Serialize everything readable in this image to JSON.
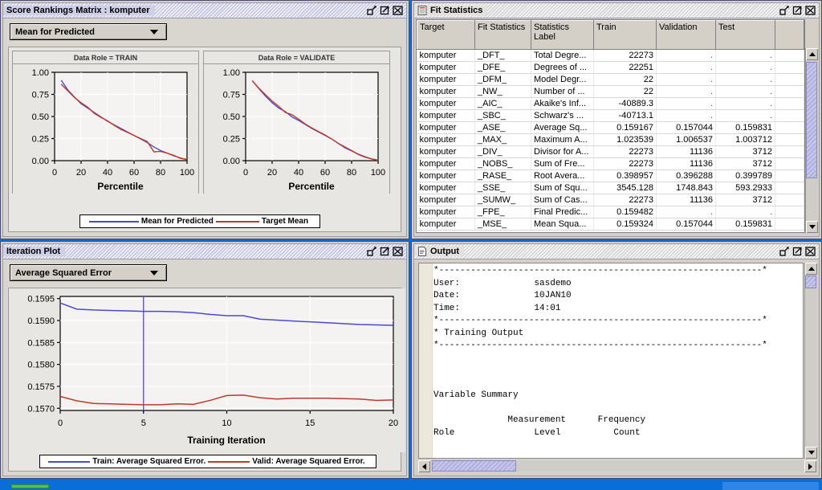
{
  "windows": {
    "score_rankings": {
      "title": "Score Rankings Matrix : komputer",
      "combo_value": "Mean for Predicted",
      "panels": [
        {
          "header": "Data Role = TRAIN",
          "xlabel": "Percentile"
        },
        {
          "header": "Data Role = VALIDATE",
          "xlabel": "Percentile"
        }
      ],
      "legend": [
        {
          "label": "Mean for Predicted",
          "color": "#4a4ad0"
        },
        {
          "label": "Target Mean",
          "color": "#c0392b"
        }
      ]
    },
    "fit_statistics": {
      "title": "Fit Statistics",
      "columns": [
        "Target",
        "Fit Statistics",
        "Statistics Label",
        "Train",
        "Validation",
        "Test",
        ""
      ],
      "rows": [
        [
          "komputer",
          "_DFT_",
          "Total Degre...",
          "22273",
          ".",
          "."
        ],
        [
          "komputer",
          "_DFE_",
          "Degrees of ...",
          "22251",
          ".",
          "."
        ],
        [
          "komputer",
          "_DFM_",
          "Model Degr...",
          "22",
          ".",
          "."
        ],
        [
          "komputer",
          "_NW_",
          "Number of ...",
          "22",
          ".",
          "."
        ],
        [
          "komputer",
          "_AIC_",
          "Akaike's Inf...",
          "-40889.3",
          ".",
          "."
        ],
        [
          "komputer",
          "_SBC_",
          "Schwarz's ...",
          "-40713.1",
          ".",
          "."
        ],
        [
          "komputer",
          "_ASE_",
          "Average Sq...",
          "0.159167",
          "0.157044",
          "0.159831"
        ],
        [
          "komputer",
          "_MAX_",
          "Maximum A...",
          "1.023539",
          "1.006537",
          "1.003712"
        ],
        [
          "komputer",
          "_DIV_",
          "Divisor for A...",
          "22273",
          "11136",
          "3712"
        ],
        [
          "komputer",
          "_NOBS_",
          "Sum of Fre...",
          "22273",
          "11136",
          "3712"
        ],
        [
          "komputer",
          "_RASE_",
          "Root Avera...",
          "0.398957",
          "0.396288",
          "0.399789"
        ],
        [
          "komputer",
          "_SSE_",
          "Sum of Squ...",
          "3545.128",
          "1748.843",
          "593.2933"
        ],
        [
          "komputer",
          "_SUMW_",
          "Sum of Cas...",
          "22273",
          "11136",
          "3712"
        ],
        [
          "komputer",
          "_FPE_",
          "Final Predic...",
          "0.159482",
          ".",
          "."
        ],
        [
          "komputer",
          "_MSE_",
          "Mean Squa...",
          "0.159324",
          "0.157044",
          "0.159831"
        ]
      ]
    },
    "iteration_plot": {
      "title": "Iteration Plot",
      "combo_value": "Average Squared Error",
      "legend": [
        {
          "label": "Train: Average Squared Error.",
          "color": "#4a4ad0"
        },
        {
          "label": "Valid: Average Squared Error.",
          "color": "#c0392b"
        }
      ]
    },
    "output": {
      "title": "Output",
      "text": "*-------------------------------------------------------------*\nUser:              sasdemo\nDate:              10JAN10\nTime:              14:01\n*-------------------------------------------------------------*\n* Training Output\n*-------------------------------------------------------------*\n\n\n\nVariable Summary\n\n              Measurement      Frequency\nRole               Level          Count"
    }
  },
  "titlebar_buttons": [
    {
      "name": "restore-button",
      "glyph": "restore"
    },
    {
      "name": "maximize-button",
      "glyph": "maximize"
    },
    {
      "name": "close-button",
      "glyph": "close"
    }
  ],
  "chart_data": [
    {
      "type": "line",
      "title": "Data Role = TRAIN",
      "xlabel": "Percentile",
      "ylabel": "",
      "xlim": [
        0,
        100
      ],
      "ylim": [
        0.0,
        1.0
      ],
      "xticks": [
        0,
        20,
        40,
        60,
        80,
        100
      ],
      "yticks": [
        "0.00",
        "0.25",
        "0.50",
        "0.75",
        "1.00"
      ],
      "grid": true,
      "legend_position": "bottom",
      "x": [
        5,
        10,
        15,
        20,
        25,
        30,
        35,
        40,
        45,
        50,
        55,
        60,
        65,
        70,
        75,
        80,
        85,
        90,
        95,
        100
      ],
      "series": [
        {
          "name": "Mean for Predicted",
          "color": "#4a4ad0",
          "values": [
            0.91,
            0.8,
            0.72,
            0.645,
            0.595,
            0.545,
            0.495,
            0.445,
            0.405,
            0.365,
            0.325,
            0.285,
            0.245,
            0.205,
            0.155,
            0.115,
            0.085,
            0.055,
            0.03,
            0.01
          ]
        },
        {
          "name": "Target Mean",
          "color": "#c0392b",
          "values": [
            0.865,
            0.79,
            0.715,
            0.655,
            0.605,
            0.535,
            0.49,
            0.45,
            0.4,
            0.355,
            0.32,
            0.285,
            0.25,
            0.215,
            0.1,
            0.105,
            0.085,
            0.06,
            0.025,
            0.015
          ]
        }
      ]
    },
    {
      "type": "line",
      "title": "Data Role = VALIDATE",
      "xlabel": "Percentile",
      "ylabel": "",
      "xlim": [
        0,
        100
      ],
      "ylim": [
        0.0,
        1.0
      ],
      "xticks": [
        0,
        20,
        40,
        60,
        80,
        100
      ],
      "yticks": [
        "0.00",
        "0.25",
        "0.50",
        "0.75",
        "1.00"
      ],
      "grid": true,
      "legend_position": "bottom",
      "x": [
        5,
        10,
        15,
        20,
        25,
        30,
        35,
        40,
        45,
        50,
        55,
        60,
        65,
        70,
        75,
        80,
        85,
        90,
        95,
        100
      ],
      "series": [
        {
          "name": "Mean for Predicted",
          "color": "#4a4ad0",
          "values": [
            0.905,
            0.815,
            0.73,
            0.655,
            0.595,
            0.555,
            0.495,
            0.455,
            0.41,
            0.365,
            0.325,
            0.285,
            0.245,
            0.195,
            0.145,
            0.11,
            0.075,
            0.045,
            0.02,
            0.005
          ]
        },
        {
          "name": "Target Mean",
          "color": "#c0392b",
          "values": [
            0.905,
            0.82,
            0.745,
            0.675,
            0.615,
            0.545,
            0.52,
            0.47,
            0.415,
            0.37,
            0.33,
            0.29,
            0.245,
            0.195,
            0.155,
            0.115,
            0.07,
            0.04,
            0.02,
            0.005
          ]
        }
      ]
    },
    {
      "type": "line",
      "title": "Iteration Plot",
      "xlabel": "Training Iteration",
      "ylabel": "",
      "xlim": [
        0,
        20
      ],
      "ylim": [
        0.15695,
        0.15955
      ],
      "xticks": [
        0,
        5,
        10,
        15,
        20
      ],
      "yticks": [
        "0.1570",
        "0.1575",
        "0.1580",
        "0.1585",
        "0.1590",
        "0.1595"
      ],
      "grid": true,
      "legend_position": "bottom",
      "reference_line_x": 5,
      "x": [
        0,
        1,
        2,
        3,
        4,
        5,
        6,
        7,
        8,
        9,
        10,
        11,
        12,
        13,
        14,
        15,
        16,
        17,
        18,
        19,
        20
      ],
      "series": [
        {
          "name": "Train: Average Squared Error.",
          "color": "#4a4ad0",
          "values": [
            0.1594,
            0.15926,
            0.15924,
            0.15923,
            0.15922,
            0.15921,
            0.15921,
            0.1592,
            0.15918,
            0.15914,
            0.15911,
            0.15911,
            0.15903,
            0.15901,
            0.15899,
            0.15897,
            0.15895,
            0.15893,
            0.15891,
            0.1589,
            0.15889
          ]
        },
        {
          "name": "Valid: Average Squared Error.",
          "color": "#c0392b",
          "values": [
            0.15727,
            0.15717,
            0.15711,
            0.1571,
            0.15709,
            0.15708,
            0.15708,
            0.1571,
            0.15709,
            0.15718,
            0.15729,
            0.1573,
            0.15724,
            0.15721,
            0.15723,
            0.15723,
            0.15723,
            0.15722,
            0.15721,
            0.15718,
            0.15719
          ]
        }
      ]
    }
  ]
}
